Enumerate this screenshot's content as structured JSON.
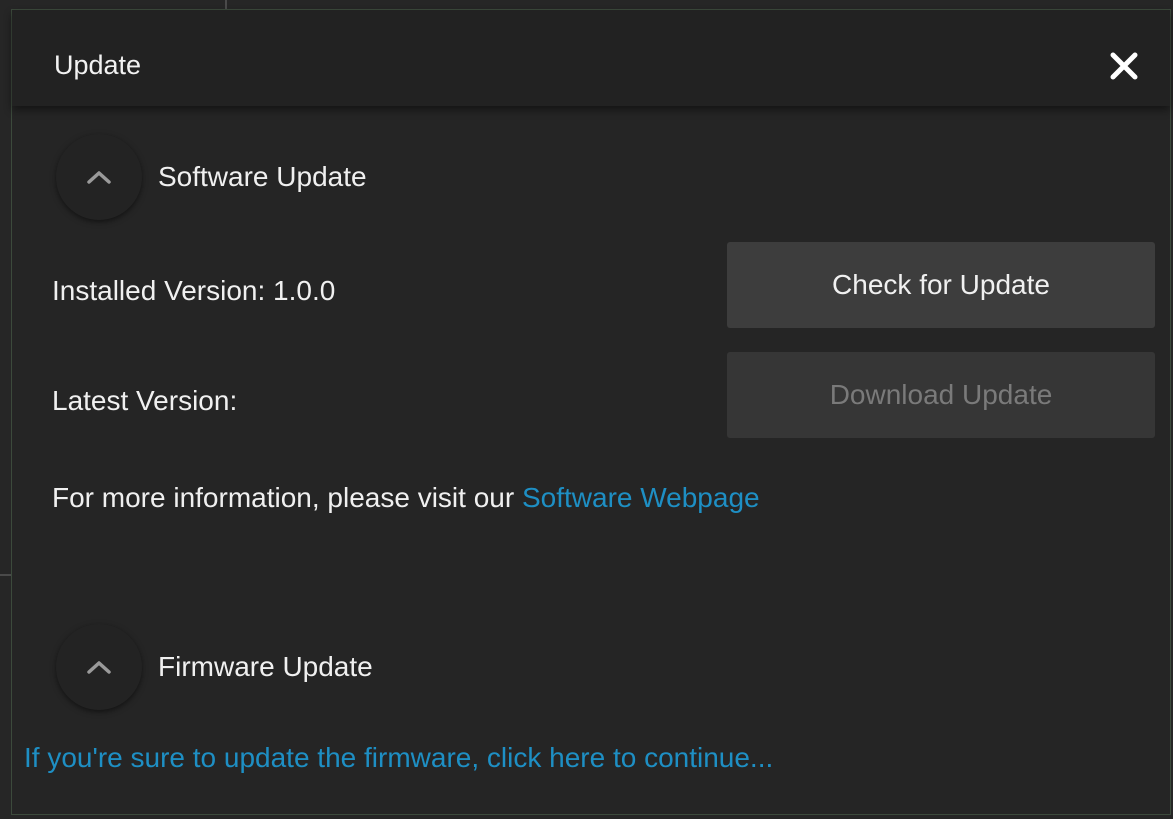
{
  "dialog": {
    "title": "Update"
  },
  "software": {
    "title": "Software Update",
    "installed_label": "Installed Version:  1.0.0",
    "latest_label": "Latest Version:",
    "check_button": "Check for Update",
    "download_button": "Download Update",
    "info_text": "For more information, please visit our ",
    "info_link": "Software Webpage"
  },
  "firmware": {
    "title": "Firmware Update",
    "continue_link": "If you're sure to update the firmware, click here to continue..."
  },
  "icons": {
    "close": "close-icon",
    "collapse": "chevron-up-icon"
  },
  "colors": {
    "background": "#252525",
    "titlebar": "#222222",
    "button": "#3d3d3d",
    "button_disabled": "#363636",
    "link": "#1e8fc4",
    "text": "#f0f0f0"
  }
}
